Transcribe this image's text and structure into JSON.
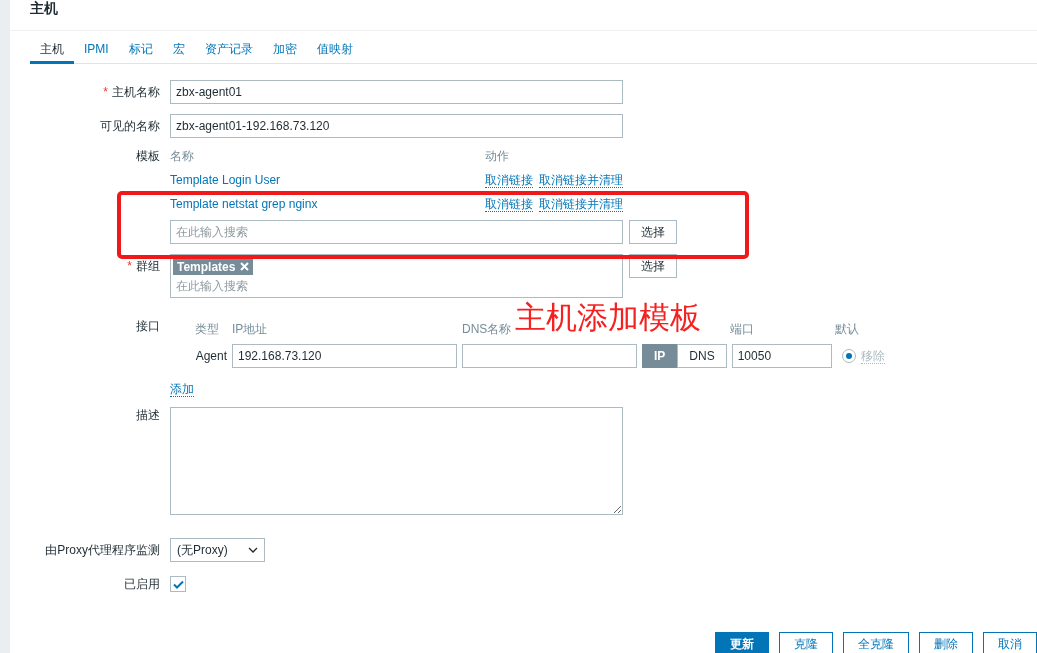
{
  "window": {
    "title": "主机"
  },
  "tabs": [
    {
      "label": "主机",
      "selected": true
    },
    {
      "label": "IPMI",
      "selected": false
    },
    {
      "label": "标记",
      "selected": false
    },
    {
      "label": "宏",
      "selected": false
    },
    {
      "label": "资产记录",
      "selected": false
    },
    {
      "label": "加密",
      "selected": false
    },
    {
      "label": "值映射",
      "selected": false
    }
  ],
  "host_name": {
    "label": "主机名称",
    "required_mark": "*",
    "value": "zbx-agent01"
  },
  "visible_name": {
    "label": "可见的名称",
    "value": "zbx-agent01-192.168.73.120"
  },
  "templates": {
    "label": "模板",
    "columns": [
      "名称",
      "动作"
    ],
    "rows": [
      {
        "name": "Template Login User",
        "actions": [
          "取消链接",
          "取消链接并清理"
        ]
      },
      {
        "name": "Template netstat grep nginx",
        "actions": [
          "取消链接",
          "取消链接并清理"
        ]
      }
    ],
    "placeholder": "在此输入搜索",
    "button": "选择"
  },
  "groups": {
    "label": "群组",
    "required_mark": "*",
    "tags": [
      "Templates"
    ],
    "placeholder": "在此输入搜索",
    "button": "选择"
  },
  "interfaces": {
    "label": "接口",
    "columns": [
      "类型",
      "IP地址",
      "DNS名称",
      "端口",
      "默认"
    ],
    "rows": [
      {
        "type": "Agent",
        "ip": "192.168.73.120",
        "connect": [
          {
            "label": "IP",
            "selected": true
          },
          {
            "label": "DNS",
            "selected": false
          }
        ],
        "port": "10050",
        "default": true,
        "remove": "移除"
      }
    ],
    "add": "添加"
  },
  "description": {
    "label": "描述"
  },
  "proxy": {
    "label": "由Proxy代理程序监测",
    "value": "(无Proxy)"
  },
  "enabled": {
    "label": "已启用",
    "checked": true
  },
  "buttons": [
    {
      "label": "更新",
      "kind": "primary"
    },
    {
      "label": "克隆",
      "kind": "normal"
    },
    {
      "label": "全克隆",
      "kind": "normal"
    },
    {
      "label": "删除",
      "kind": "normal"
    },
    {
      "label": "取消",
      "kind": "normal"
    }
  ],
  "annotation": {
    "text": "主机添加模板"
  }
}
